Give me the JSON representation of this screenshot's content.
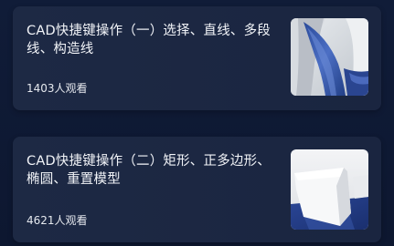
{
  "cards": [
    {
      "title": "CAD快捷键操作（一）选择、直线、多段线、构造线",
      "views": "1403人观看"
    },
    {
      "title": "CAD快捷键操作（二）矩形、正多边形、椭圆、重置模型",
      "views": "4621人观看"
    }
  ]
}
